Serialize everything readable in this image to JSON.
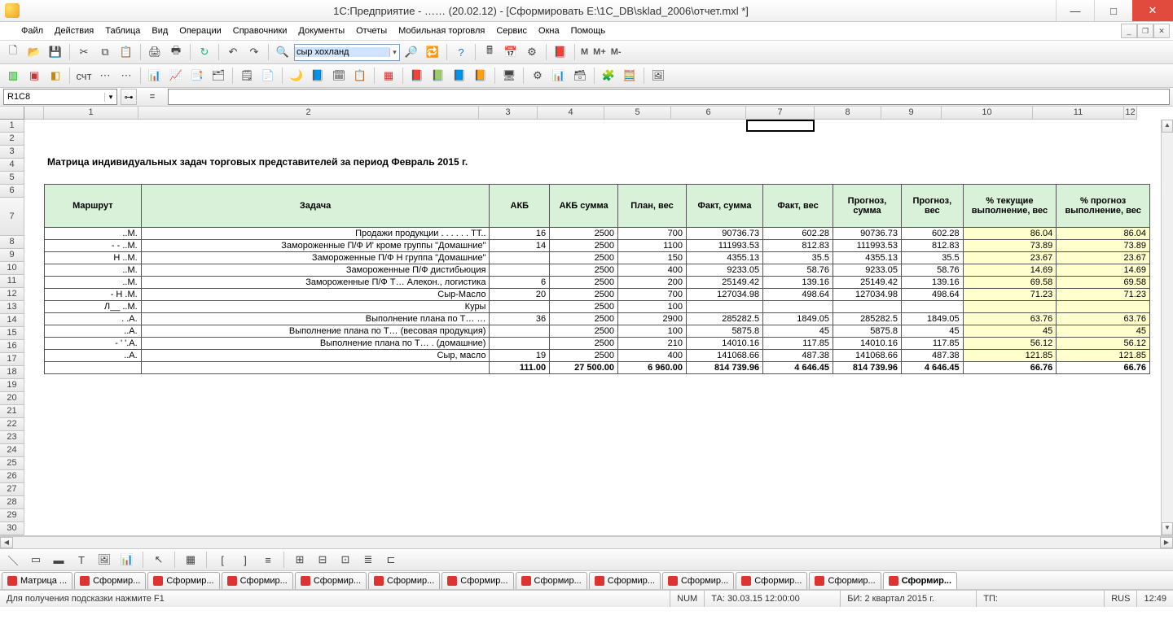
{
  "title": "1С:Предприятие -  ……  (20.02.12) - [Сформировать E:\\1C_DB\\sklad_2006\\отчет.mxl *]",
  "menu": [
    "Файл",
    "Действия",
    "Таблица",
    "Вид",
    "Операции",
    "Справочники",
    "Документы",
    "Отчеты",
    "Мобильная торговля",
    "Сервис",
    "Окна",
    "Помощь"
  ],
  "search_value": "сыр хохланд",
  "mlabels": [
    "M",
    "M+",
    "M-"
  ],
  "cellref": "R1C8",
  "col_heads": [
    "",
    "1",
    "2",
    "3",
    "4",
    "5",
    "6",
    "7",
    "8",
    "9",
    "10",
    "11",
    "12",
    "1"
  ],
  "report_title": "Матрица индивидуальных задач торговых представителей за период Февраль 2015 г.",
  "headers": [
    "Маршрут",
    "Задача",
    "АКБ",
    "АКБ сумма",
    "План, вес",
    "Факт, сумма",
    "Факт, вес",
    "Прогноз, сумма",
    "Прогноз, вес",
    "% текущие выполнение, вес",
    "% прогноз выполнение, вес"
  ],
  "rows": [
    {
      "n": 8,
      "m": "..М.",
      "t": "Продажи продукции                   . .   . .            . . ТТ..",
      "akb": "16",
      "akbs": "2500",
      "plan": "700",
      "fs": "90736.73",
      "fv": "602.28",
      "ps": "90736.73",
      "pv": "602.28",
      "pc": "86.04",
      "pp": "86.04"
    },
    {
      "n": 9,
      "m": "- -     ..М.",
      "t": "Замороженные П/Ф И'            кроме группы \"Домашние\"",
      "akb": "14",
      "akbs": "2500",
      "plan": "1100",
      "fs": "111993.53",
      "fv": "812.83",
      "ps": "111993.53",
      "pv": "812.83",
      "pc": "73.89",
      "pp": "73.89"
    },
    {
      "n": 10,
      "m": "Н    ..М.",
      "t": "Замороженные П/Ф Н           группа \"Домашние\"",
      "akb": "",
      "akbs": "2500",
      "plan": "150",
      "fs": "4355.13",
      "fv": "35.5",
      "ps": "4355.13",
      "pv": "35.5",
      "pc": "23.67",
      "pp": "23.67"
    },
    {
      "n": 11,
      "m": "..М.",
      "t": "Замороженные П/Ф             дистибьюция",
      "akb": "",
      "akbs": "2500",
      "plan": "400",
      "fs": "9233.05",
      "fv": "58.76",
      "ps": "9233.05",
      "pv": "58.76",
      "pc": "14.69",
      "pp": "14.69"
    },
    {
      "n": 12,
      "m": "..М.",
      "t": "Замороженные П/Ф Т… Алекон., логистика",
      "akb": "6",
      "akbs": "2500",
      "plan": "200",
      "fs": "25149.42",
      "fv": "139.16",
      "ps": "25149.42",
      "pv": "139.16",
      "pc": "69.58",
      "pp": "69.58"
    },
    {
      "n": 13,
      "m": "-      Н .М.",
      "t": "Сыр-Масло",
      "akb": "20",
      "akbs": "2500",
      "plan": "700",
      "fs": "127034.98",
      "fv": "498.64",
      "ps": "127034.98",
      "pv": "498.64",
      "pc": "71.23",
      "pp": "71.23"
    },
    {
      "n": 14,
      "m": "Л__    ..М.",
      "t": "Куры",
      "akb": "",
      "akbs": "2500",
      "plan": "100",
      "fs": "",
      "fv": "",
      "ps": "",
      "pv": "",
      "pc": "",
      "pp": ""
    },
    {
      "n": 15,
      "m": ". .А.",
      "t": "Выполнение плана по Т…           …",
      "akb": "36",
      "akbs": "2500",
      "plan": "2900",
      "fs": "285282.5",
      "fv": "1849.05",
      "ps": "285282.5",
      "pv": "1849.05",
      "pc": "63.76",
      "pp": "63.76"
    },
    {
      "n": 16,
      "m": "..А.",
      "t": "Выполнение плана по Т…         (весовая продукция)",
      "akb": "",
      "akbs": "2500",
      "plan": "100",
      "fs": "5875.8",
      "fv": "45",
      "ps": "5875.8",
      "pv": "45",
      "pc": "45",
      "pp": "45"
    },
    {
      "n": 17,
      "m": "-    '   '.А.",
      "t": "Выполнение плана по Т… .         (домашние)",
      "akb": "",
      "akbs": "2500",
      "plan": "210",
      "fs": "14010.16",
      "fv": "117.85",
      "ps": "14010.16",
      "pv": "117.85",
      "pc": "56.12",
      "pp": "56.12"
    },
    {
      "n": 18,
      "m": "..А.",
      "t": "Сыр, масло",
      "akb": "19",
      "akbs": "2500",
      "plan": "400",
      "fs": "141068.66",
      "fv": "487.38",
      "ps": "141068.66",
      "pv": "487.38",
      "pc": "121.85",
      "pp": "121.85"
    }
  ],
  "total": {
    "n": 19,
    "akb": "111.00",
    "akbs": "27 500.00",
    "plan": "6 960.00",
    "fs": "814 739.96",
    "fv": "4 646.45",
    "ps": "814 739.96",
    "pv": "4 646.45",
    "pc": "66.76",
    "pp": "66.76"
  },
  "tabs": [
    "Матрица ...",
    "Сформир...",
    "Сформир...",
    "Сформир...",
    "Сформир...",
    "Сформир...",
    "Сформир...",
    "Сформир...",
    "Сформир...",
    "Сформир...",
    "Сформир...",
    "Сформир...",
    "Сформир..."
  ],
  "status_hint": "Для получения подсказки нажмите F1",
  "status_num": "NUM",
  "status_ta": "ТА: 30.03.15  12:00:00",
  "status_bi": "БИ: 2 квартал 2015 г.",
  "status_tp": "ТП:",
  "status_lang": "RUS",
  "status_time": "12:49"
}
